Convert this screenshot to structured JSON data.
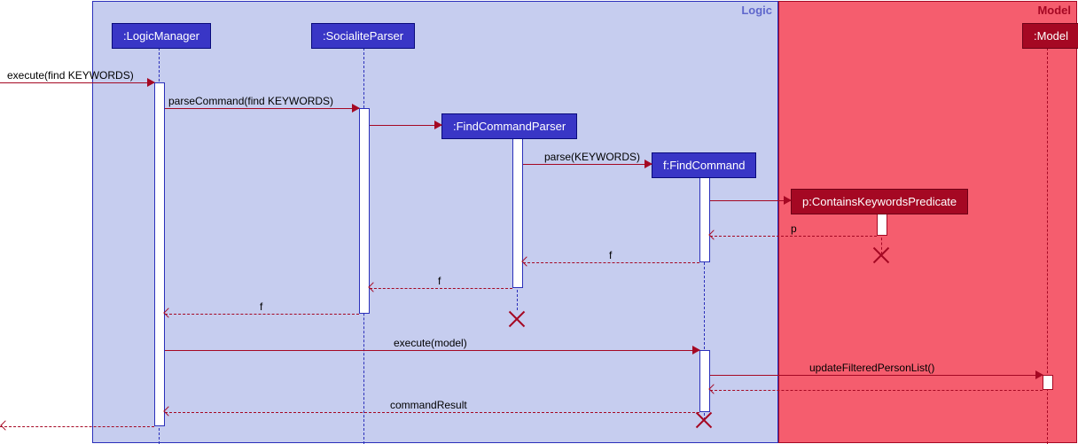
{
  "frames": {
    "logic": "Logic",
    "model": "Model"
  },
  "participants": {
    "logicManager": ":LogicManager",
    "socialiteParser": ":SocialiteParser",
    "findCommandParser": ":FindCommandParser",
    "findCommand": "f:FindCommand",
    "predicate": "p:ContainsKeywordsPredicate",
    "model": ":Model"
  },
  "messages": {
    "execute1": "execute(find KEYWORDS)",
    "parseCommand": "parseCommand(find KEYWORDS)",
    "parse": "parse(KEYWORDS)",
    "returnP": "p",
    "returnF1": "f",
    "returnF2": "f",
    "returnF3": "f",
    "executeModel": "execute(model)",
    "updateList": "updateFilteredPersonList()",
    "commandResult": "commandResult"
  }
}
